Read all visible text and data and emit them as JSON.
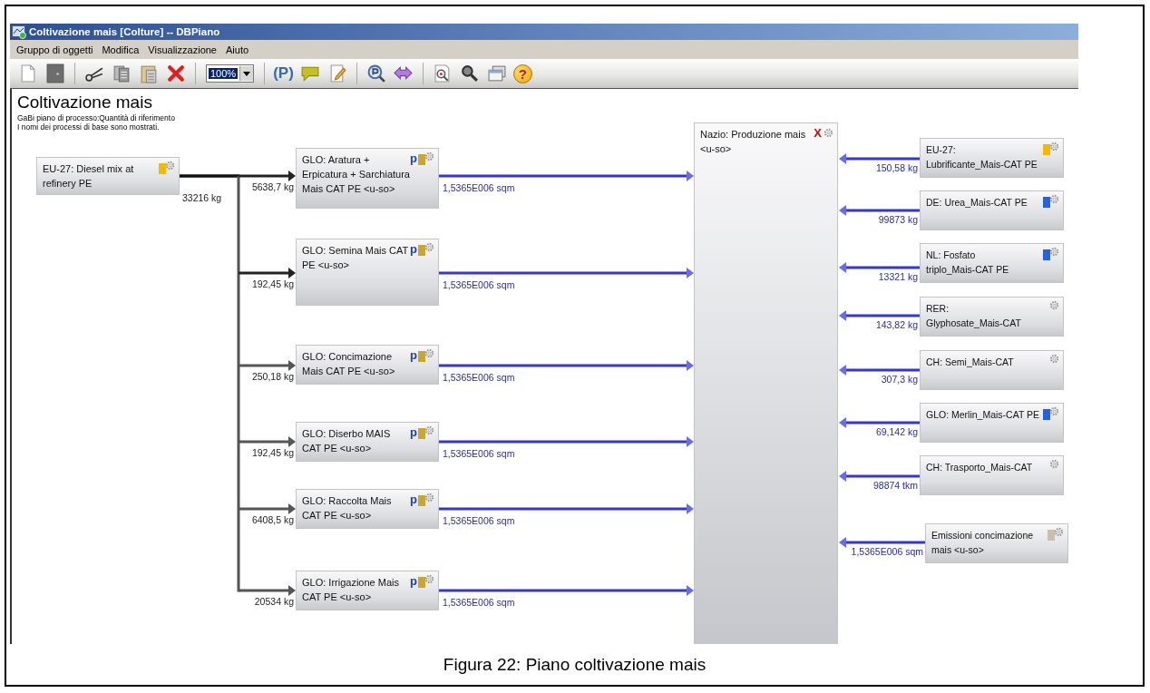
{
  "window": {
    "title": "Coltivazione mais [Colture] -- DBPiano"
  },
  "menu": [
    "Gruppo di oggetti",
    "Modifica",
    "Visualizzazione",
    "Aiuto"
  ],
  "toolbar": [
    {
      "kind": "new"
    },
    {
      "kind": "save"
    },
    {
      "kind": "separator"
    },
    {
      "kind": "cut"
    },
    {
      "kind": "copy"
    },
    {
      "kind": "paste"
    },
    {
      "kind": "delete"
    },
    {
      "kind": "separator"
    },
    {
      "kind": "zoom",
      "value": "100%"
    },
    {
      "kind": "separator"
    },
    {
      "kind": "parameter",
      "text": "(P)"
    },
    {
      "kind": "comment"
    },
    {
      "kind": "edit"
    },
    {
      "kind": "separator"
    },
    {
      "kind": "parameter-search"
    },
    {
      "kind": "arrows"
    },
    {
      "kind": "separator"
    },
    {
      "kind": "preview"
    },
    {
      "kind": "search"
    },
    {
      "kind": "windows"
    },
    {
      "kind": "help",
      "text": "?"
    }
  ],
  "diagram": {
    "title": "Coltivazione mais",
    "subtitle_lines": [
      "GaBi piano di processo:Quantità di riferimento",
      "I nomi dei processi di base sono mostrati."
    ],
    "source": {
      "label": "EU-27: Diesel mix at refinery PE",
      "color": "#f5b800",
      "amount": "33216 kg"
    },
    "steps": [
      {
        "label": "GLO: Aratura + Erpicatura + Sarchiatura Mais CAT PE <u-so>",
        "marker": "p",
        "color": "#c9a634",
        "input_amount": "5638,7 kg",
        "output_amount": "1,5365E006 sqm"
      },
      {
        "label": "GLO: Semina Mais CAT PE <u-so>",
        "marker": "p",
        "color": "#c9a634",
        "input_amount": "192,45 kg",
        "output_amount": "1,5365E006 sqm"
      },
      {
        "label": "GLO: Concimazione Mais CAT PE <u-so>",
        "marker": "p",
        "color": "#c9a634",
        "input_amount": "250,18 kg",
        "output_amount": "1,5365E006 sqm"
      },
      {
        "label": "GLO: Diserbo MAIS CAT PE <u-so>",
        "marker": "p",
        "color": "#c9a634",
        "input_amount": "192,45 kg",
        "output_amount": "1,5365E006 sqm"
      },
      {
        "label": "GLO: Raccolta Mais CAT PE <u-so>",
        "marker": "p",
        "color": "#c9a634",
        "input_amount": "6408,5 kg",
        "output_amount": "1,5365E006 sqm"
      },
      {
        "label": "GLO: Irrigazione Mais CAT PE <u-so>",
        "marker": "p",
        "color": "#c9a634",
        "input_amount": "20534 kg",
        "output_amount": "1,5365E006 sqm"
      }
    ],
    "target": {
      "label": "Nazio: Produzione mais <u-so>",
      "marker": "X"
    },
    "inputs": [
      {
        "label": "EU-27: Lubrificante_Mais-CAT PE",
        "color": "#f5b800",
        "amount": "150,58 kg"
      },
      {
        "label": "DE: Urea_Mais-CAT PE",
        "color": "#2462e0",
        "amount": "99873 kg"
      },
      {
        "label": "NL: Fosfato triplo_Mais-CAT PE",
        "color": "#2462e0",
        "amount": "13321 kg"
      },
      {
        "label": "RER: Glyphosate_Mais-CAT",
        "amount": "143,82 kg"
      },
      {
        "label": "CH: Semi_Mais-CAT",
        "amount": "307,3 kg"
      },
      {
        "label": "GLO: Merlin_Mais-CAT PE",
        "color": "#2462e0",
        "amount": "69,142 kg"
      },
      {
        "label": "CH: Trasporto_Mais-CAT",
        "amount": "98874 tkm"
      },
      {
        "label": "Emissioni concimazione mais <u-so>",
        "color": "#c8bfb0",
        "amount": "1,5365E006 sqm"
      }
    ]
  },
  "caption": "Figura 22: Piano coltivazione mais"
}
